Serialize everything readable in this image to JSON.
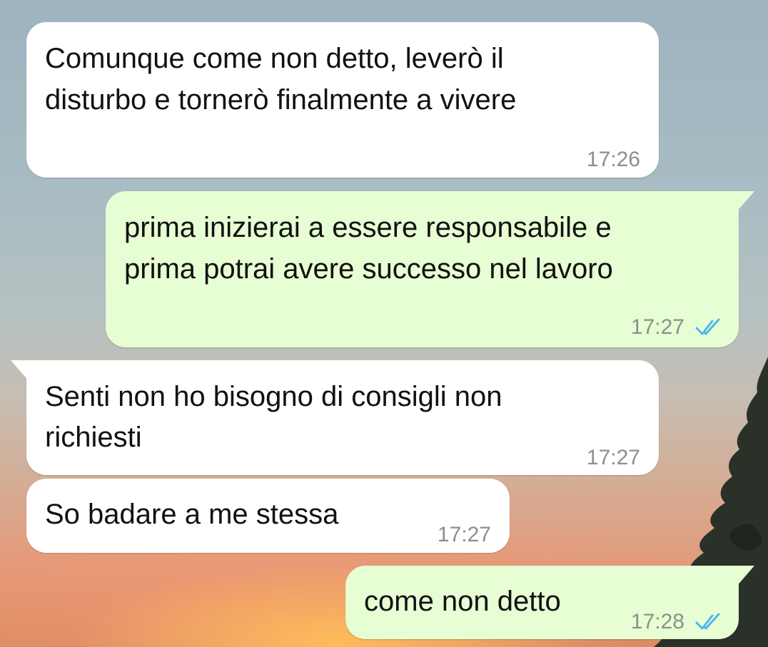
{
  "messages": [
    {
      "id": "m1",
      "direction": "incoming",
      "lines": [
        "Comunque come non detto, leverò il",
        "disturbo e tornerò finalmente a vivere"
      ],
      "time": "17:26"
    },
    {
      "id": "m2",
      "direction": "outgoing",
      "lines": [
        "prima inizierai a essere responsabile e",
        "prima potrai avere successo nel lavoro"
      ],
      "time": "17:27",
      "read_icon": "double-check-icon"
    },
    {
      "id": "m3",
      "direction": "incoming",
      "lines": [
        "Senti non ho bisogno di consigli non",
        "richiesti"
      ],
      "time": "17:27"
    },
    {
      "id": "m4",
      "direction": "incoming",
      "lines": [
        "So badare a me stessa"
      ],
      "time": "17:27"
    },
    {
      "id": "m5",
      "direction": "outgoing",
      "lines": [
        "come non detto"
      ],
      "time": "17:28",
      "read_icon": "double-check-icon"
    }
  ],
  "colors": {
    "incoming_bubble": "#ffffff",
    "outgoing_bubble": "#e7fdd3",
    "read_ticks": "#4fb6ec",
    "timestamp": "#8a918c"
  }
}
